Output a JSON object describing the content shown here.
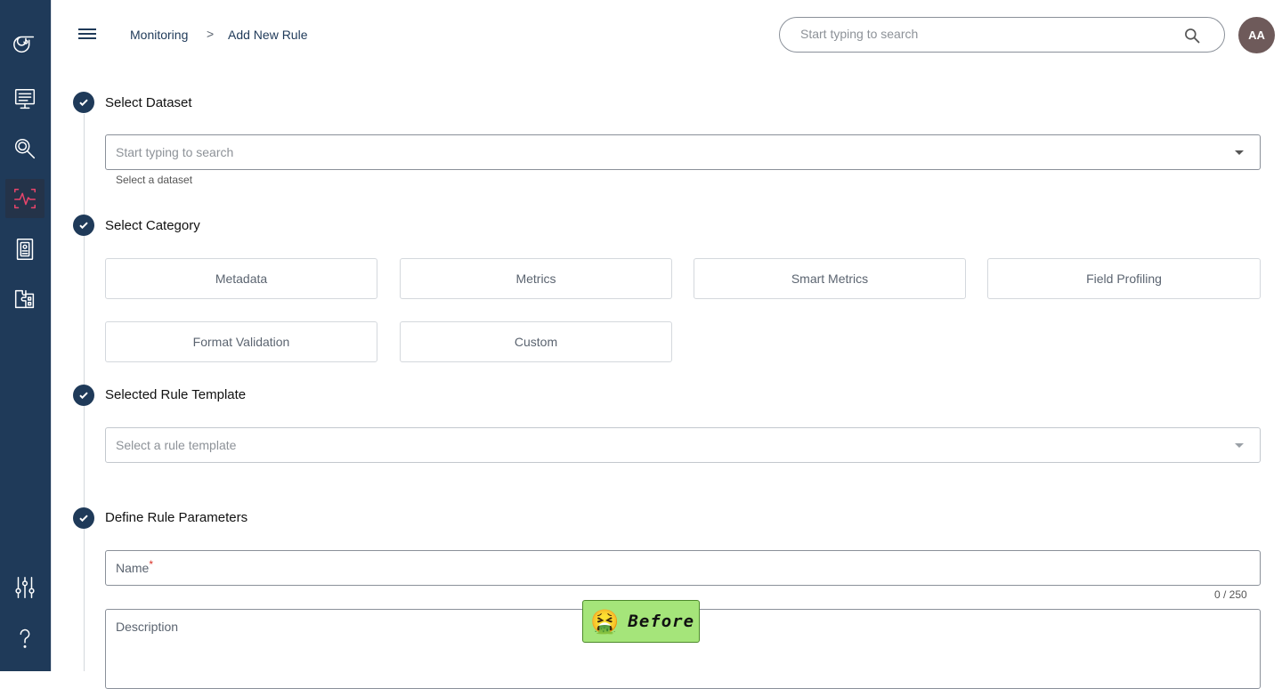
{
  "sidebar": {
    "items": [
      {
        "icon": "logo-icon",
        "active": false
      },
      {
        "icon": "monitor-icon",
        "active": false
      },
      {
        "icon": "search-data-icon",
        "active": false
      },
      {
        "icon": "activity-monitoring-icon",
        "active": true
      },
      {
        "icon": "document-icon",
        "active": false
      },
      {
        "icon": "puzzle-icon",
        "active": false
      },
      {
        "icon": "settings-sliders-icon",
        "active": false
      },
      {
        "icon": "help-icon",
        "active": false
      }
    ],
    "active_color": "#e8456b",
    "background": "#1f3a59"
  },
  "header": {
    "breadcrumb": [
      "Monitoring",
      "Add New Rule"
    ],
    "breadcrumb_separator": ">",
    "search_placeholder": "Start typing to search",
    "avatar_initials": "AA"
  },
  "steps": {
    "dataset": {
      "title": "Select Dataset",
      "placeholder": "Start typing to search",
      "helper": "Select a dataset"
    },
    "category": {
      "title": "Select Category",
      "options": [
        "Metadata",
        "Metrics",
        "Smart Metrics",
        "Field Profiling",
        "Format Validation",
        "Custom"
      ]
    },
    "template": {
      "title": "Selected Rule Template",
      "placeholder": "Select a rule template"
    },
    "parameters": {
      "title": "Define Rule Parameters",
      "name_label": "Name",
      "required_mark": "*",
      "name_counter": "0 / 250",
      "description_label": "Description"
    }
  },
  "overlay_badge": {
    "emoji": "🤮",
    "text": "Before"
  }
}
